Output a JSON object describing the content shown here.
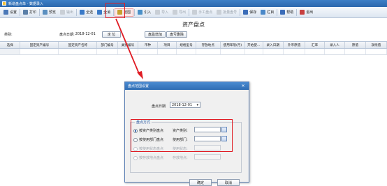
{
  "window": {
    "title": "新增盘点单 - 数据录入"
  },
  "toolbar": {
    "items": [
      {
        "label": "设置",
        "icon": "settings-icon",
        "color": "#4a78b8",
        "disabled": false
      },
      {
        "label": "打印",
        "icon": "print-icon",
        "color": "#5a7fa8",
        "disabled": false
      },
      {
        "label": "预览",
        "icon": "preview-icon",
        "color": "#5a8fc0",
        "disabled": false
      },
      {
        "label": "输出",
        "icon": "export-icon",
        "color": "#888888",
        "disabled": true
      },
      {
        "label": "全选",
        "icon": "select-all-icon",
        "color": "#3a7ac8",
        "disabled": false
      },
      {
        "label": "全消",
        "icon": "deselect-all-icon",
        "color": "#3a7ac8",
        "disabled": false
      },
      {
        "label": "范围",
        "icon": "range-icon",
        "color": "#c8a030",
        "disabled": false,
        "active": true
      },
      {
        "label": "引入",
        "icon": "import-icon",
        "color": "#4a90c8",
        "disabled": false
      },
      {
        "label": "导入",
        "icon": "import-file-icon",
        "color": "#888888",
        "disabled": true
      },
      {
        "label": "导出",
        "icon": "export-file-icon",
        "color": "#888888",
        "disabled": true
      },
      {
        "label": "手工盘点",
        "icon": "manual-count-icon",
        "color": "#888888",
        "disabled": true
      },
      {
        "label": "批量盘号",
        "icon": "batch-icon",
        "color": "#888888",
        "disabled": true
      },
      {
        "label": "保存",
        "icon": "save-icon",
        "color": "#3a6cb8",
        "disabled": false
      },
      {
        "label": "栏目",
        "icon": "columns-icon",
        "color": "#4a88c8",
        "disabled": false
      },
      {
        "label": "帮助",
        "icon": "help-icon",
        "color": "#3a6cb8",
        "disabled": false
      },
      {
        "label": "退出",
        "icon": "exit-icon",
        "color": "#c84040",
        "disabled": false
      }
    ]
  },
  "document": {
    "title": "资产盘点",
    "category_label": "类别:",
    "date_label": "盘点日期:",
    "date_value": "2018-12-01",
    "locate_button": "定 位",
    "batch_add_button": "盘盈增加",
    "delete_button": "盘亏删除"
  },
  "grid": {
    "columns": [
      "选择",
      "固定资产编号",
      "固定资产名称",
      "部门编号",
      "类别编号",
      "币种",
      "项目",
      "规格型号",
      "存放地点",
      "使用年限(月)",
      "开始使…",
      "录入日期",
      "外币原值",
      "汇率",
      "录入人",
      "原值",
      "净残值"
    ]
  },
  "dialog": {
    "title": "盘点范围设置",
    "date_label": "盘点日期",
    "date_value": "2018-12-01",
    "group_label": "盘点方式",
    "options": [
      {
        "label": "按资产类别盘点",
        "field_label": "资产类别:",
        "checked": true,
        "disabled": false
      },
      {
        "label": "按使用部门盘点",
        "field_label": "使用部门:",
        "checked": false,
        "disabled": false
      },
      {
        "label": "按使用状态盘点",
        "field_label": "使用状态:",
        "checked": false,
        "disabled": true
      },
      {
        "label": "按存放地点盘点",
        "field_label": "存放地点:",
        "checked": false,
        "disabled": true
      }
    ],
    "ok_button": "确定",
    "cancel_button": "取消"
  }
}
